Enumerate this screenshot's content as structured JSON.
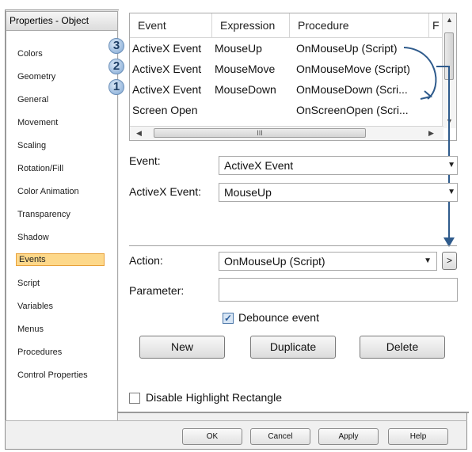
{
  "left_pane": {
    "title": "Properties - Object",
    "items": [
      "Colors",
      "Geometry",
      "General",
      "Movement",
      "Scaling",
      "Rotation/Fill",
      "Color Animation",
      "Transparency",
      "Shadow",
      "Events",
      "Script",
      "Variables",
      "Menus",
      "Procedures",
      "Control Properties"
    ],
    "selected": "Events"
  },
  "grid": {
    "columns": [
      "Event",
      "Expression",
      "Procedure",
      "F"
    ],
    "rows": [
      {
        "event": "ActiveX Event",
        "expression": "MouseUp",
        "procedure": "OnMouseUp (Script)",
        "badge": "3"
      },
      {
        "event": "ActiveX Event",
        "expression": "MouseMove",
        "procedure": "OnMouseMove (Script)",
        "badge": "2"
      },
      {
        "event": "ActiveX Event",
        "expression": "MouseDown",
        "procedure": "OnMouseDown (Scri...",
        "badge": "1"
      },
      {
        "event": "Screen Open",
        "expression": "",
        "procedure": "OnScreenOpen (Scri...",
        "badge": ""
      }
    ],
    "hscroll_grip": "III"
  },
  "form": {
    "event_label": "Event:",
    "event_value": "ActiveX Event",
    "activex_label": "ActiveX Event:",
    "activex_value": "MouseUp",
    "action_label": "Action:",
    "action_value": "OnMouseUp (Script)",
    "action_more": ">",
    "parameter_label": "Parameter:",
    "parameter_value": "",
    "debounce_label": "Debounce event",
    "debounce_checked": true,
    "new_label": "New",
    "duplicate_label": "Duplicate",
    "delete_label": "Delete",
    "disable_label": "Disable Highlight Rectangle",
    "disable_checked": false
  },
  "footer": {
    "ok": "OK",
    "cancel": "Cancel",
    "apply": "Apply",
    "help": "Help"
  },
  "colors": {
    "selected_item_bg": "#fdd88a",
    "annotation_arrow": "#2f5b8c"
  }
}
